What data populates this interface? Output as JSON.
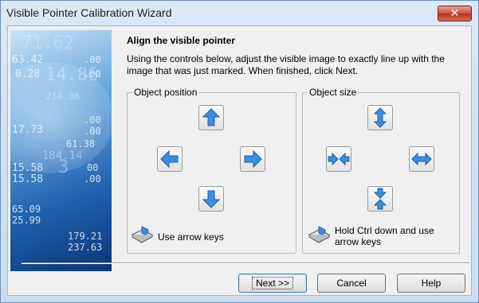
{
  "window": {
    "title": "Visible Pointer Calibration Wizard",
    "close_glyph": "✕"
  },
  "banner": {
    "numbers": [
      "71.62",
      "63.42",
      ".00",
      "0.28",
      "14.86",
      ".00",
      "214.06",
      ".00",
      "17.73",
      ".00",
      "61.38",
      "184.14",
      "15.58",
      "3",
      "00",
      "15.58",
      ".00",
      "65.09",
      "25.99",
      "179.21",
      "237.63"
    ]
  },
  "page": {
    "heading": "Align the visible pointer",
    "description": "Using the controls below, adjust the visible image to exactly line up with the image that was just marked. When finished, click Next."
  },
  "position_group": {
    "label": "Object position",
    "hint": "Use arrow keys",
    "icons": [
      "arrow-up-icon",
      "arrow-left-icon",
      "arrow-right-icon",
      "arrow-down-icon"
    ]
  },
  "size_group": {
    "label": "Object size",
    "hint": "Hold Ctrl down and use arrow keys",
    "icons": [
      "stretch-vertical-icon",
      "shrink-horizontal-icon",
      "stretch-horizontal-icon",
      "shrink-vertical-icon"
    ]
  },
  "buttons": {
    "next": "Next >>",
    "cancel": "Cancel",
    "help": "Help"
  },
  "colors": {
    "arrow_fill": "#3d8ee0",
    "arrow_stroke": "#1c5fa8",
    "title_bar": "#c9dcf0",
    "close_button": "#c6503e"
  }
}
